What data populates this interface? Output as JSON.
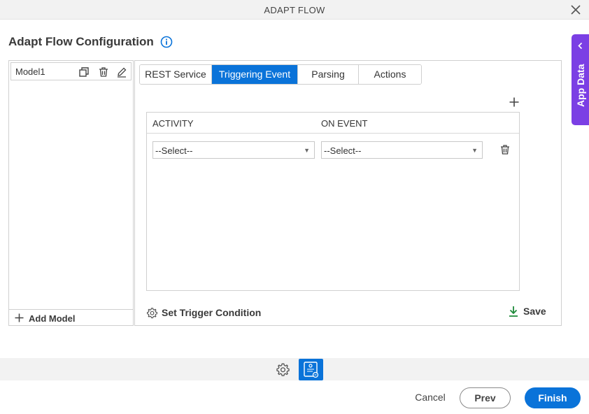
{
  "window": {
    "title": "ADAPT FLOW",
    "close_icon": "close-icon"
  },
  "heading": {
    "title": "Adapt Flow Configuration",
    "info_icon": "info-icon"
  },
  "side_tab": {
    "label": "App Data",
    "color": "#7b3fe4"
  },
  "models": {
    "items": [
      {
        "name": "Model1",
        "icons": [
          "copy-icon",
          "trash-icon",
          "edit-icon"
        ]
      }
    ],
    "add_label": "Add Model"
  },
  "tabs": [
    {
      "label": "REST Service",
      "active": false
    },
    {
      "label": "Triggering Event",
      "active": true
    },
    {
      "label": "Parsing",
      "active": false
    },
    {
      "label": "Actions",
      "active": false
    }
  ],
  "trigger_grid": {
    "columns": [
      "ACTIVITY",
      "ON EVENT"
    ],
    "rows": [
      {
        "activity": "--Select--",
        "on_event": "--Select--"
      }
    ]
  },
  "footer_actions": {
    "set_trigger_condition": "Set Trigger Condition",
    "save": "Save"
  },
  "buttons": {
    "cancel": "Cancel",
    "prev": "Prev",
    "finish": "Finish"
  },
  "colors": {
    "accent": "#0a73d9",
    "save_icon": "#1e8a3a"
  }
}
